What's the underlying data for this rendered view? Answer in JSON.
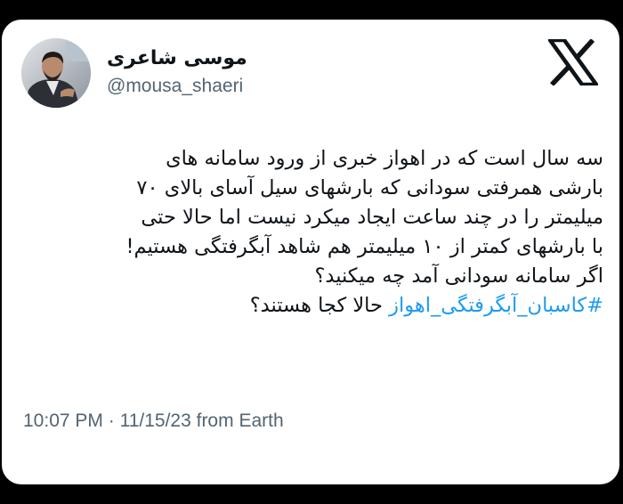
{
  "author": {
    "display_name": "موسی شاعری",
    "handle": "@mousa_shaeri",
    "avatar_icon": "person-photo-avatar"
  },
  "brand": {
    "logo_icon": "x-logo-icon"
  },
  "tweet": {
    "lines": [
      "سه سال است که در اهواز خبری از ورود سامانه های",
      "بارشی همرفتی سودانی که بارشهای سیل آسای بالای ۷۰",
      "میلیمتر را در چند ساعت ایجاد میکرد نیست اما حالا حتی",
      "با بارشهای کمتر از ۱۰ میلیمتر هم شاهد آبگرفتگی هستیم!",
      "اگر سامانه سودانی آمد چه میکنید؟"
    ],
    "hashtag": "#کاسبان_آبگرفتگی_اهواز",
    "last_line_rest": "حالا کجا هستند؟"
  },
  "meta": {
    "time": "10:07 PM",
    "separator": "·",
    "date": "11/15/23",
    "source": "from Earth"
  },
  "colors": {
    "text": "#0f1419",
    "secondary": "#536471",
    "link": "#1d9bf0",
    "background": "#ffffff",
    "frame": "#000000"
  }
}
